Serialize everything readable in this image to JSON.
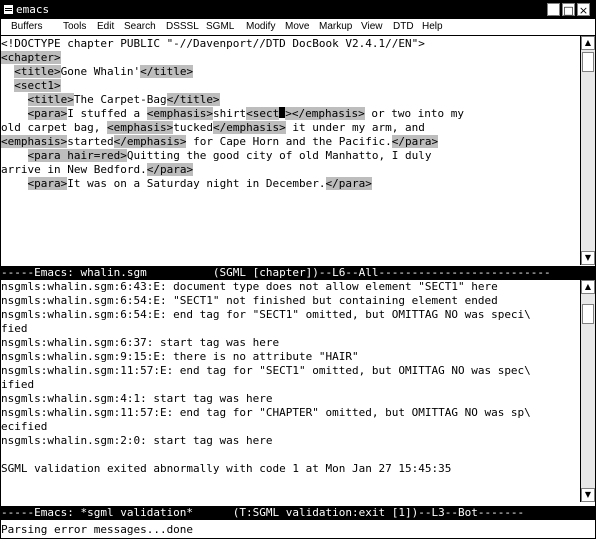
{
  "window": {
    "title": "emacs",
    "minimize_label": "_",
    "maximize_label": "□",
    "close_label": "×"
  },
  "menubar": {
    "items": [
      "Buffers",
      "Tools",
      "Edit",
      "Search",
      "DSSSL",
      "SGML",
      "Modify",
      "Move",
      "Markup",
      "View",
      "DTD",
      "Help"
    ]
  },
  "editor": {
    "lines": [
      [
        {
          "t": "<!DOCTYPE chapter PUBLIC \"-//Davenport//DTD DocBook V2.4.1//EN\">",
          "tag": false
        }
      ],
      [
        {
          "t": "<chapter>",
          "tag": true
        }
      ],
      [
        {
          "t": "  ",
          "tag": false
        },
        {
          "t": "<title>",
          "tag": true
        },
        {
          "t": "Gone Whalin'",
          "tag": false
        },
        {
          "t": "</title>",
          "tag": true
        }
      ],
      [
        {
          "t": "  ",
          "tag": false
        },
        {
          "t": "<sect1>",
          "tag": true
        }
      ],
      [
        {
          "t": "    ",
          "tag": false
        },
        {
          "t": "<title>",
          "tag": true
        },
        {
          "t": "The Carpet-Bag",
          "tag": false
        },
        {
          "t": "</title>",
          "tag": true
        }
      ],
      [
        {
          "t": "    ",
          "tag": false
        },
        {
          "t": "<para>",
          "tag": true
        },
        {
          "t": "I stuffed a ",
          "tag": false
        },
        {
          "t": "<emphasis>",
          "tag": true
        },
        {
          "t": "shirt",
          "tag": false
        },
        {
          "t": "<sect",
          "tag": true
        },
        {
          "cursor": true
        },
        {
          "t": ">",
          "tag": true
        },
        {
          "t": "</emphasis>",
          "tag": true
        },
        {
          "t": " or two into my",
          "tag": false
        }
      ],
      [
        {
          "t": "old carpet bag, ",
          "tag": false
        },
        {
          "t": "<emphasis>",
          "tag": true
        },
        {
          "t": "tucked",
          "tag": false
        },
        {
          "t": "</emphasis>",
          "tag": true
        },
        {
          "t": " it under my arm, and",
          "tag": false
        }
      ],
      [
        {
          "t": "<emphasis>",
          "tag": true
        },
        {
          "t": "started",
          "tag": false
        },
        {
          "t": "</emphasis>",
          "tag": true
        },
        {
          "t": " for Cape Horn and the Pacific.",
          "tag": false
        },
        {
          "t": "</para>",
          "tag": true
        }
      ],
      [
        {
          "t": "    ",
          "tag": false
        },
        {
          "t": "<para hair=red>",
          "tag": true
        },
        {
          "t": "Quitting the good city of old Manhatto, I duly",
          "tag": false
        }
      ],
      [
        {
          "t": "arrive in New Bedford.",
          "tag": false
        },
        {
          "t": "</para>",
          "tag": true
        }
      ],
      [
        {
          "t": "    ",
          "tag": false
        },
        {
          "t": "<para>",
          "tag": true
        },
        {
          "t": "It was on a Saturday night in December.",
          "tag": false
        },
        {
          "t": "</para>",
          "tag": true
        }
      ]
    ]
  },
  "modeline_top": "-----Emacs: whalin.sgm          (SGML [chapter])--L6--All--------------------------",
  "output": {
    "lines": [
      "nsgmls:whalin.sgm:6:43:E: document type does not allow element \"SECT1\" here",
      "nsgmls:whalin.sgm:6:54:E: \"SECT1\" not finished but containing element ended",
      "nsgmls:whalin.sgm:6:54:E: end tag for \"SECT1\" omitted, but OMITTAG NO was speci\\",
      "fied",
      "nsgmls:whalin.sgm:6:37: start tag was here",
      "nsgmls:whalin.sgm:9:15:E: there is no attribute \"HAIR\"",
      "nsgmls:whalin.sgm:11:57:E: end tag for \"SECT1\" omitted, but OMITTAG NO was spec\\",
      "ified",
      "nsgmls:whalin.sgm:4:1: start tag was here",
      "nsgmls:whalin.sgm:11:57:E: end tag for \"CHAPTER\" omitted, but OMITTAG NO was sp\\",
      "ecified",
      "nsgmls:whalin.sgm:2:0: start tag was here",
      "",
      "SGML validation exited abnormally with code 1 at Mon Jan 27 15:45:35",
      ""
    ]
  },
  "modeline_bottom": "-----Emacs: *sgml validation*      (T:SGML validation:exit [1])--L3--Bot-------",
  "minibuffer": "Parsing error messages...done"
}
